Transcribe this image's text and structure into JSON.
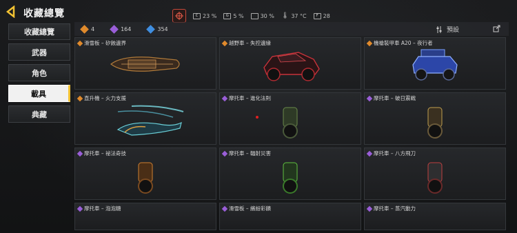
{
  "header": {
    "title": "收藏總覽",
    "status": {
      "cpu": "23 %",
      "gpu": "5 %",
      "battery": "30 %",
      "temp": "37 °C",
      "fps": "28"
    }
  },
  "sidebar": {
    "items": [
      {
        "label": "收藏總覽"
      },
      {
        "label": "武器"
      },
      {
        "label": "角色"
      },
      {
        "label": "載具",
        "active": true
      },
      {
        "label": "典藏"
      }
    ]
  },
  "currency": {
    "orange": "4",
    "purple": "164",
    "blue": "354",
    "preset_label": "預設"
  },
  "vehicles": [
    {
      "label": "滑雪板 – 矽蝕邊界",
      "rarity": "orange"
    },
    {
      "label": "越野車 – 失控邊緣",
      "rarity": "orange"
    },
    {
      "label": "機槍裝甲車 A20 – 夜行者",
      "rarity": "orange"
    },
    {
      "label": "直升機 – 火力支援",
      "rarity": "orange"
    },
    {
      "label": "摩托車 – 進化法則",
      "rarity": "purple"
    },
    {
      "label": "摩托車 – 破日震戰",
      "rarity": "purple"
    },
    {
      "label": "摩托車 – 祕法奇技",
      "rarity": "purple"
    },
    {
      "label": "摩托車 – 輻射災害",
      "rarity": "purple"
    },
    {
      "label": "摩托車 – 八方飛刀",
      "rarity": "purple"
    },
    {
      "label": "摩托車 – 泡泡糖",
      "rarity": "purple"
    },
    {
      "label": "滑雪板 – 繽紛彩饋",
      "rarity": "purple"
    },
    {
      "label": "摩托車 – 蒸汽動力",
      "rarity": "purple"
    }
  ],
  "colors": {
    "accent": "#f2c233",
    "orange": "#e08a2c",
    "purple": "#9a5ed8",
    "blue": "#3f8ee0"
  }
}
